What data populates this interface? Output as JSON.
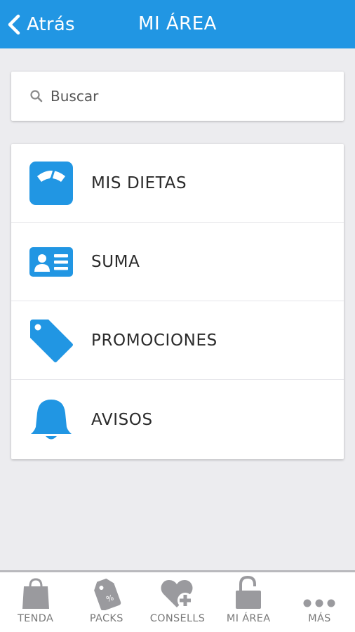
{
  "header": {
    "back_label": "Atrás",
    "title": "MI ÁREA"
  },
  "search": {
    "placeholder": "Buscar",
    "icon": "search-icon"
  },
  "menu": {
    "items": [
      {
        "label": "MIS DIETAS",
        "icon": "scale-icon"
      },
      {
        "label": "SUMA",
        "icon": "id-card-icon"
      },
      {
        "label": "PROMOCIONES",
        "icon": "tag-icon"
      },
      {
        "label": "AVISOS",
        "icon": "bell-icon"
      }
    ]
  },
  "tabbar": {
    "items": [
      {
        "label": "TENDA",
        "icon": "shopping-bag-icon"
      },
      {
        "label": "PACKS",
        "icon": "discount-tag-icon"
      },
      {
        "label": "CONSELLS",
        "icon": "heart-plus-icon"
      },
      {
        "label": "MI ÁREA",
        "icon": "unlock-icon"
      },
      {
        "label": "MÁS",
        "icon": "more-dots-icon"
      }
    ]
  },
  "colors": {
    "accent": "#2196e3",
    "background": "#ececef",
    "tab_icon": "#9a9a9e",
    "tab_label": "#7a7a7a"
  }
}
